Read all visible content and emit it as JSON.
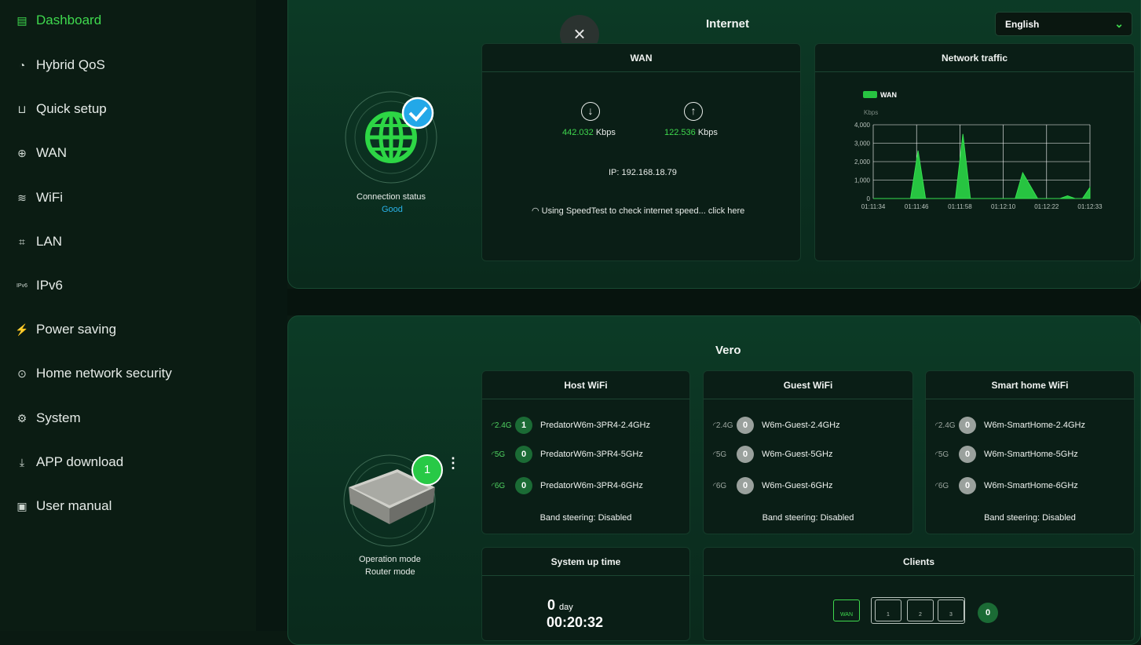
{
  "sidebar": {
    "items": [
      {
        "label": "Dashboard",
        "icon": "dashboard-icon",
        "glyph": "▤"
      },
      {
        "label": "Hybrid QoS",
        "icon": "gauge-icon",
        "glyph": "◔"
      },
      {
        "label": "Quick setup",
        "icon": "router-setup-icon",
        "glyph": "⊔"
      },
      {
        "label": "WAN",
        "icon": "globe-icon",
        "glyph": "⊕"
      },
      {
        "label": "WiFi",
        "icon": "wifi-icon",
        "glyph": "≋"
      },
      {
        "label": "LAN",
        "icon": "lan-icon",
        "glyph": "⌗"
      },
      {
        "label": "IPv6",
        "icon": "ipv6-icon",
        "glyph": "IPv6"
      },
      {
        "label": "Power saving",
        "icon": "lightning-icon",
        "glyph": "⚡"
      },
      {
        "label": "Home network security",
        "icon": "shield-search-icon",
        "glyph": "⊙"
      },
      {
        "label": "System",
        "icon": "wrench-icon",
        "glyph": "⚙"
      },
      {
        "label": "APP download",
        "icon": "download-icon",
        "glyph": "⤓"
      },
      {
        "label": "User manual",
        "icon": "manual-icon",
        "glyph": "▣"
      }
    ]
  },
  "header": {
    "language": "English"
  },
  "internet": {
    "title": "Internet",
    "connection_label": "Connection status",
    "connection_value": "Good",
    "wan": {
      "title": "WAN",
      "download_value": "442.032",
      "upload_value": "122.536",
      "unit": "Kbps",
      "ip": "IP: 192.168.18.79",
      "speedtest": "Using SpeedTest to check internet speed... click here"
    }
  },
  "chart_data": {
    "type": "area",
    "title": "Network traffic",
    "series": [
      {
        "name": "WAN",
        "values": [
          0,
          0,
          0,
          0,
          0,
          0,
          2600,
          0,
          0,
          0,
          0,
          0,
          3500,
          0,
          0,
          0,
          0,
          0,
          0,
          0,
          1400,
          700,
          0,
          0,
          0,
          0,
          150,
          0,
          0,
          600
        ]
      }
    ],
    "x_ticks": [
      "01:11:34",
      "01:11:46",
      "01:11:58",
      "01:12:10",
      "01:12:22",
      "01:12:33"
    ],
    "ylabel": "Kbps",
    "y_ticks": [
      "0",
      "1,000",
      "2,000",
      "3,000",
      "4,000"
    ],
    "ylim": [
      0,
      4000
    ],
    "legend_position": "top-left",
    "color": "#27c441"
  },
  "vero": {
    "title": "Vero",
    "device_count": "1",
    "operation_label": "Operation mode",
    "operation_value": "Router mode",
    "host": {
      "title": "Host WiFi",
      "rows": [
        {
          "band": "2.4G",
          "count": "1",
          "ssid": "PredatorW6m-3PR4-2.4GHz"
        },
        {
          "band": "5G",
          "count": "0",
          "ssid": "PredatorW6m-3PR4-5GHz"
        },
        {
          "band": "6G",
          "count": "0",
          "ssid": "PredatorW6m-3PR4-6GHz"
        }
      ],
      "band_steering": "Band steering: Disabled"
    },
    "guest": {
      "title": "Guest WiFi",
      "rows": [
        {
          "band": "2.4G",
          "count": "0",
          "ssid": "W6m-Guest-2.4GHz"
        },
        {
          "band": "5G",
          "count": "0",
          "ssid": "W6m-Guest-5GHz"
        },
        {
          "band": "6G",
          "count": "0",
          "ssid": "W6m-Guest-6GHz"
        }
      ],
      "band_steering": "Band steering: Disabled"
    },
    "smart": {
      "title": "Smart home WiFi",
      "rows": [
        {
          "band": "2.4G",
          "count": "0",
          "ssid": "W6m-SmartHome-2.4GHz"
        },
        {
          "band": "5G",
          "count": "0",
          "ssid": "W6m-SmartHome-5GHz"
        },
        {
          "band": "6G",
          "count": "0",
          "ssid": "W6m-SmartHome-6GHz"
        }
      ],
      "band_steering": "Band steering: Disabled"
    },
    "uptime": {
      "title": "System up time",
      "days": "0",
      "day_label": "day",
      "time": "00:20:32"
    },
    "clients": {
      "title": "Clients",
      "wan_port": "WAN",
      "ports": [
        "1",
        "2",
        "3"
      ],
      "count": "0"
    }
  }
}
